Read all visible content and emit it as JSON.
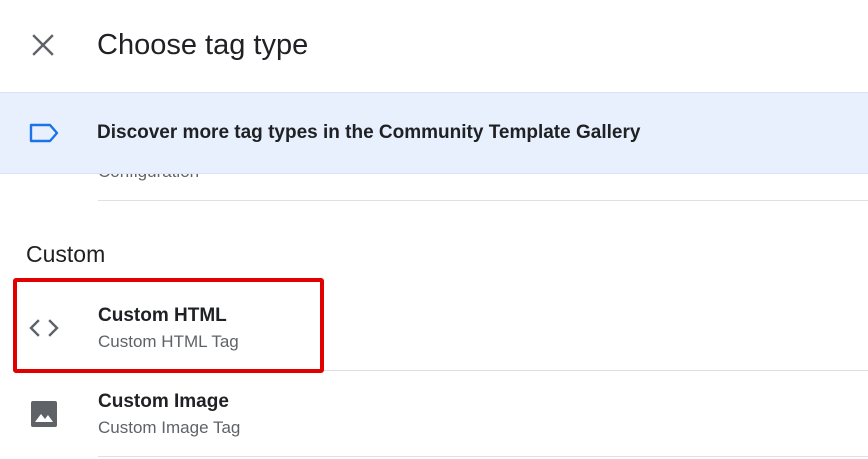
{
  "dialog": {
    "title": "Choose tag type",
    "close_icon": "close-icon"
  },
  "banner": {
    "icon": "label-icon",
    "text": "Discover more tag types in the Community Template Gallery",
    "accent_color": "#1a73e8",
    "background": "#e8f0fe"
  },
  "previous_item": {
    "subtitle": "Configuration"
  },
  "custom_section": {
    "heading": "Custom",
    "items": [
      {
        "name": "Custom HTML",
        "description": "Custom HTML Tag",
        "icon": "code-icon",
        "highlighted": true
      },
      {
        "name": "Custom Image",
        "description": "Custom Image Tag",
        "icon": "image-icon",
        "highlighted": false
      }
    ]
  },
  "highlight_color": "#e00000"
}
